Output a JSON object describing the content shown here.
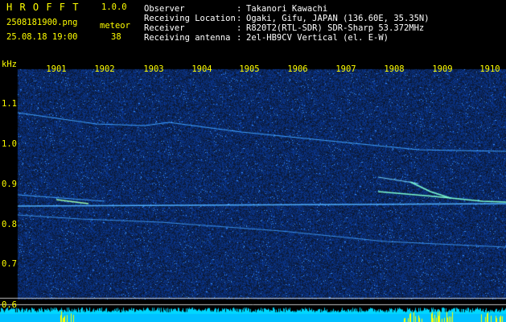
{
  "app": {
    "name": "H R O F F T",
    "version": "1.0.0"
  },
  "file": {
    "name": "2508181900.png",
    "datetime": "25.08.18 19:00"
  },
  "meteor": {
    "label": "meteor",
    "count": "38"
  },
  "info": {
    "rows": [
      {
        "key": "Observer",
        "sep": ":",
        "value": "Takanori Kawachi"
      },
      {
        "key": "Receiving Location",
        "sep": ":",
        "value": "Ogaki, Gifu, JAPAN (136.60E, 35.35N)"
      },
      {
        "key": "Receiver",
        "sep": ":",
        "value": "R820T2(RTL-SDR) SDR-Sharp 53.372MHz"
      },
      {
        "key": "Receiving antenna",
        "sep": ":",
        "value": "2el-HB9CV Vertical (el. E-W)"
      }
    ]
  },
  "spectrogram": {
    "unit": "kHz",
    "x_ticks": [
      "1901",
      "1902",
      "1903",
      "1904",
      "1905",
      "1906",
      "1907",
      "1908",
      "1909",
      "1910"
    ],
    "y_ticks": [
      "1.1",
      "1.0",
      "0.9",
      "0.8",
      "0.7",
      "0.6"
    ],
    "colors": {
      "background": "#000000",
      "noise": "#1a2fb0",
      "trace": "#6fd0ff",
      "strong": "#ffff00",
      "text": "#ffff00"
    }
  }
}
